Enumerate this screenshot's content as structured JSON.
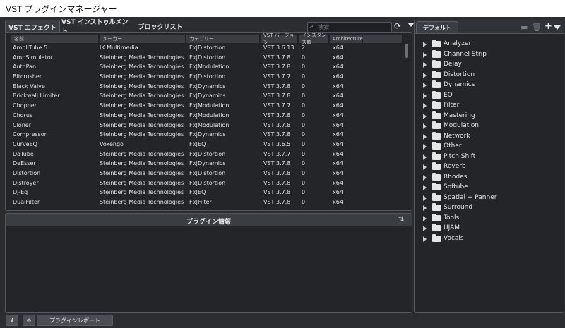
{
  "window": {
    "title": "VST プラグインマネージャー"
  },
  "tabs": [
    {
      "label": "VST エフェクト",
      "active": true
    },
    {
      "label": "VST インストゥルメント",
      "active": false
    },
    {
      "label": "ブロックリスト",
      "active": false
    }
  ],
  "search": {
    "placeholder": "検索",
    "icon": "search-icon"
  },
  "toolbar": {
    "refresh_icon": "refresh-icon",
    "menu_icon": "chevron-down-icon"
  },
  "table": {
    "columns": [
      "名前",
      "メーカー",
      "カテゴリー",
      "VST バージョン",
      "インスタンス数",
      "Architecture"
    ],
    "rows": [
      [
        "AmpliTube 5",
        "IK Multimedia",
        "Fx|Distortion",
        "VST 3.6.13",
        "2",
        "x64"
      ],
      [
        "AmpSimulator",
        "Steinberg Media Technologies",
        "Fx|Distortion",
        "VST 3.7.8",
        "0",
        "x64"
      ],
      [
        "AutoPan",
        "Steinberg Media Technologies",
        "Fx|Modulation",
        "VST 3.7.8",
        "0",
        "x64"
      ],
      [
        "Bitcrusher",
        "Steinberg Media Technologies",
        "Fx|Distortion",
        "VST 3.7.7",
        "0",
        "x64"
      ],
      [
        "Black Valve",
        "Steinberg Media Technologies",
        "Fx|Dynamics",
        "VST 3.7.8",
        "0",
        "x64"
      ],
      [
        "Brickwall Limiter",
        "Steinberg Media Technologies",
        "Fx|Dynamics",
        "VST 3.7.8",
        "0",
        "x64"
      ],
      [
        "Chopper",
        "Steinberg Media Technologies",
        "Fx|Modulation",
        "VST 3.7.7",
        "0",
        "x64"
      ],
      [
        "Chorus",
        "Steinberg Media Technologies",
        "Fx|Modulation",
        "VST 3.7.8",
        "0",
        "x64"
      ],
      [
        "Cloner",
        "Steinberg Media Technologies",
        "Fx|Modulation",
        "VST 3.7.8",
        "0",
        "x64"
      ],
      [
        "Compressor",
        "Steinberg Media Technologies",
        "Fx|Dynamics",
        "VST 3.7.8",
        "0",
        "x64"
      ],
      [
        "CurveEQ",
        "Voxengo",
        "Fx|EQ",
        "VST 3.6.5",
        "0",
        "x64"
      ],
      [
        "DaTube",
        "Steinberg Media Technologies",
        "Fx|Distortion",
        "VST 3.7.7",
        "0",
        "x64"
      ],
      [
        "DeEsser",
        "Steinberg Media Technologies",
        "Fx|Dynamics",
        "VST 3.7.8",
        "0",
        "x64"
      ],
      [
        "Distortion",
        "Steinberg Media Technologies",
        "Fx|Distortion",
        "VST 3.7.8",
        "0",
        "x64"
      ],
      [
        "Distroyer",
        "Steinberg Media Technologies",
        "Fx|Distortion",
        "VST 3.7.8",
        "0",
        "x64"
      ],
      [
        "DJ-Eq",
        "Steinberg Media Technologies",
        "Fx|EQ",
        "VST 3.7.8",
        "0",
        "x64"
      ],
      [
        "DualFilter",
        "Steinberg Media Technologies",
        "Fx|Filter",
        "VST 3.7.8",
        "0",
        "x64"
      ]
    ]
  },
  "info_panel": {
    "title": "プラグイン情報",
    "icon": "sort-icon"
  },
  "bottom": {
    "info_icon": "info-icon",
    "settings_icon": "gear-icon",
    "report_button": "プラグインレポート"
  },
  "right_panel": {
    "tab": "デフォルト",
    "icons": [
      "folder-icon",
      "trash-icon",
      "plus-icon",
      "chevron-down-icon"
    ],
    "folders": [
      "Analyzer",
      "Channel Strip",
      "Delay",
      "Distortion",
      "Dynamics",
      "EQ",
      "Filter",
      "Mastering",
      "Modulation",
      "Network",
      "Other",
      "Pitch Shift",
      "Reverb",
      "Rhodes",
      "Softube",
      "Spatial + Panner",
      "Surround",
      "Tools",
      "UJAM",
      "Vocals"
    ]
  },
  "colors": {
    "background": "#2b2d31",
    "panel": "#232528",
    "header": "#3a3d42",
    "text": "#e0e0e0",
    "border": "#55585d"
  }
}
